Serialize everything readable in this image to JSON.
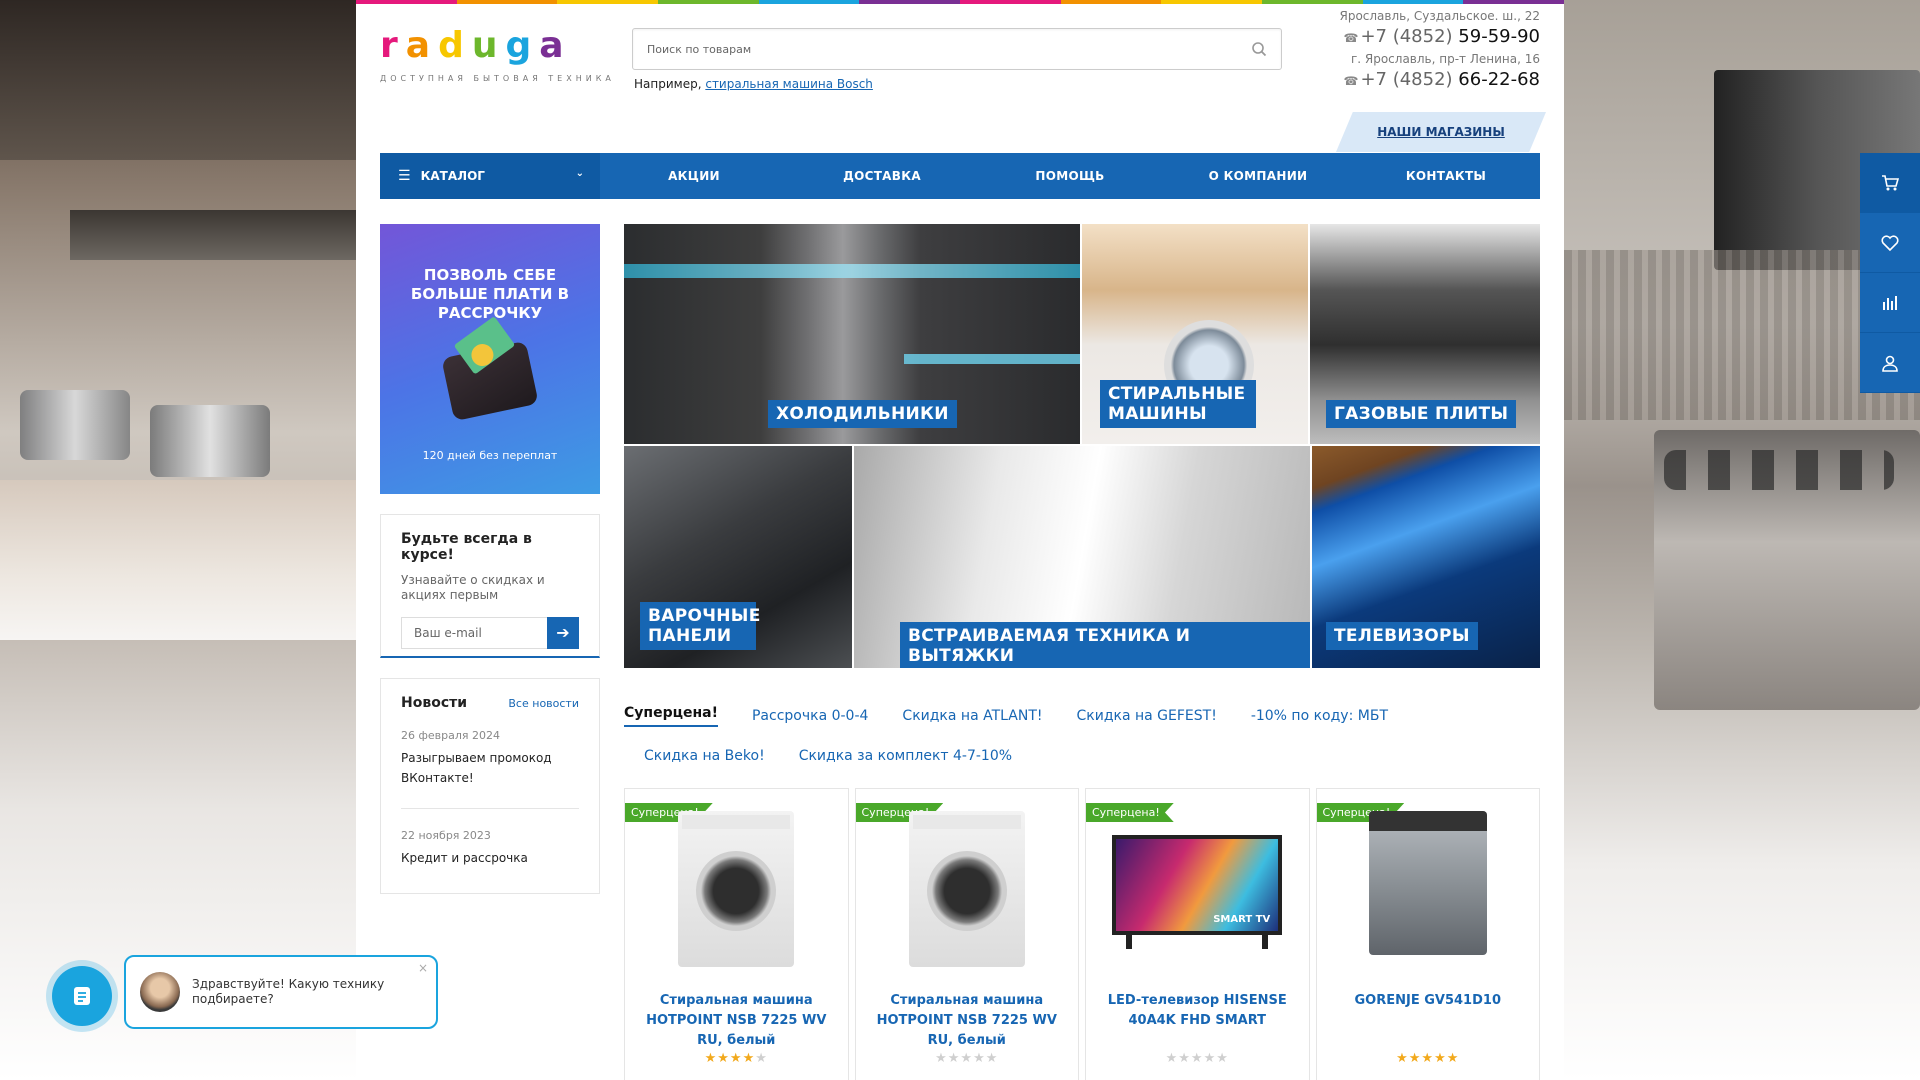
{
  "brand": {
    "logo_text": [
      "r",
      "a",
      "d",
      "u",
      "g",
      "a"
    ],
    "tagline": "ДОСТУПНАЯ БЫТОВАЯ ТЕХНИКА",
    "rainbow_colors": [
      "#e5197c",
      "#f29100",
      "#f7c700",
      "#6db72c",
      "#1aa4de",
      "#7a2f94",
      "#e5197c",
      "#f29100",
      "#f7c700",
      "#6db72c",
      "#1aa4de",
      "#7a2f94"
    ]
  },
  "search": {
    "placeholder": "Поиск по товарам",
    "example_prefix": "Например,",
    "example_link": "стиральная машина Bosch"
  },
  "contacts": {
    "addr1": "Ярославль, Суздальское. ш., 22",
    "phone1_code": "+7 (4852)",
    "phone1_num": "59-59-90",
    "addr2": "г. Ярославль, пр-т Ленина, 16",
    "phone2_code": "+7 (4852)",
    "phone2_num": "66-22-68",
    "stores_link": "НАШИ МАГАЗИНЫ"
  },
  "nav": {
    "catalog": "КАТАЛОГ",
    "items": [
      "АКЦИИ",
      "ДОСТАВКА",
      "ПОМОЩЬ",
      "О КОМПАНИИ",
      "КОНТАКТЫ"
    ]
  },
  "promo": {
    "title": "ПОЗВОЛЬ СЕБЕ БОЛЬШЕ ПЛАТИ В РАССРОЧКУ",
    "subtitle": "120 дней без переплат"
  },
  "subscribe": {
    "title": "Будьте всегда в курсе!",
    "text": "Узнавайте о скидках и акциях первым",
    "placeholder": "Ваш e-mail"
  },
  "news": {
    "title": "Новости",
    "all_link": "Все новости",
    "items": [
      {
        "date": "26 февраля 2024",
        "text": "Разыгрываем промокод ВКонтакте!"
      },
      {
        "date": "22 ноября 2023",
        "text": "Кредит и рассрочка"
      }
    ]
  },
  "categories": [
    "ХОЛОДИЛЬНИКИ",
    "СТИРАЛЬНЫЕ МАШИНЫ",
    "ГАЗОВЫЕ ПЛИТЫ",
    "ВАРОЧНЫЕ ПАНЕЛИ",
    "ВСТРАИВАЕМАЯ ТЕХНИКА И ВЫТЯЖКИ",
    "ТЕЛЕВИЗОРЫ"
  ],
  "tabs": {
    "row1": [
      "Суперцена!",
      "Рассрочка 0-0-4",
      "Скидка на ATLANT!",
      "Скидка на GEFEST!",
      "-10% по коду: МБТ"
    ],
    "row2": [
      "Скидка на Beko!",
      "Скидка за комплект 4-7-10%"
    ],
    "active_index": 0
  },
  "products": [
    {
      "badge": "Суперцена!",
      "name": "Стиральная машина HOTPOINT NSB 7225 WV RU, белый",
      "rating": 4,
      "image": "washing-machine",
      "tv_label": ""
    },
    {
      "badge": "Суперцена!",
      "name": "Стиральная машина HOTPOINT NSB 7225 WV RU, белый",
      "rating": 0,
      "image": "washing-machine",
      "tv_label": ""
    },
    {
      "badge": "Суперцена!",
      "name": "LED-телевизор HISENSE 40A4K FHD SMART",
      "rating": 0,
      "image": "tv",
      "tv_label": "SMART TV"
    },
    {
      "badge": "Суперцена!",
      "name": "GORENJE GV541D10",
      "rating": 5,
      "image": "dishwasher",
      "tv_label": ""
    }
  ],
  "sidebar_icons": [
    "cart-icon",
    "heart-icon",
    "compare-icon",
    "user-icon"
  ],
  "chat": {
    "message": "Здравствуйте! Какую технику подбираете?",
    "close": "×"
  }
}
